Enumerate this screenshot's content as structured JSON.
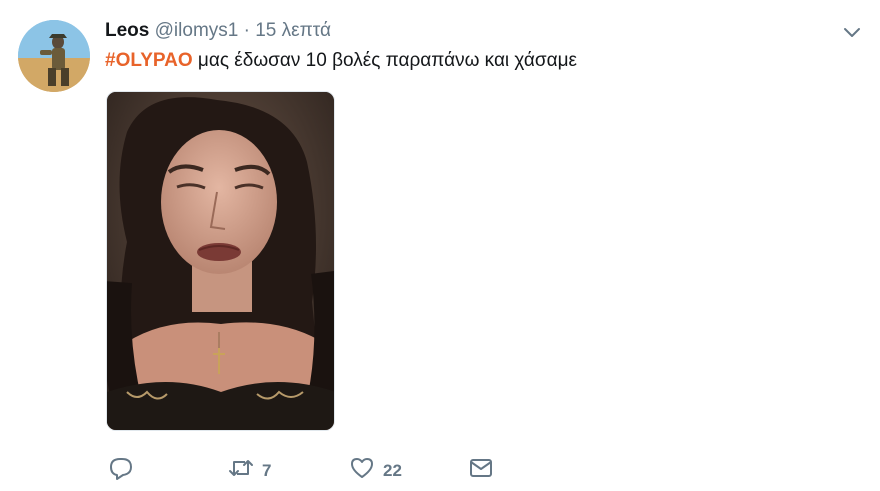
{
  "tweet": {
    "author_name": "Leos",
    "handle": "@ilomys1",
    "separator": "·",
    "time": "15 λεπτά",
    "hashtag": "#OLYPAO",
    "text": " μας έδωσαν 10 βολές παραπάνω και χάσαμε"
  },
  "actions": {
    "reply_count": "",
    "retweet_count": "7",
    "like_count": "22"
  },
  "icons": {
    "more": "chevron-down-icon",
    "reply": "reply-icon",
    "retweet": "retweet-icon",
    "like": "heart-icon",
    "message": "envelope-icon"
  },
  "colors": {
    "hashtag": "#e8632a",
    "muted": "#657786",
    "text": "#14171a"
  }
}
